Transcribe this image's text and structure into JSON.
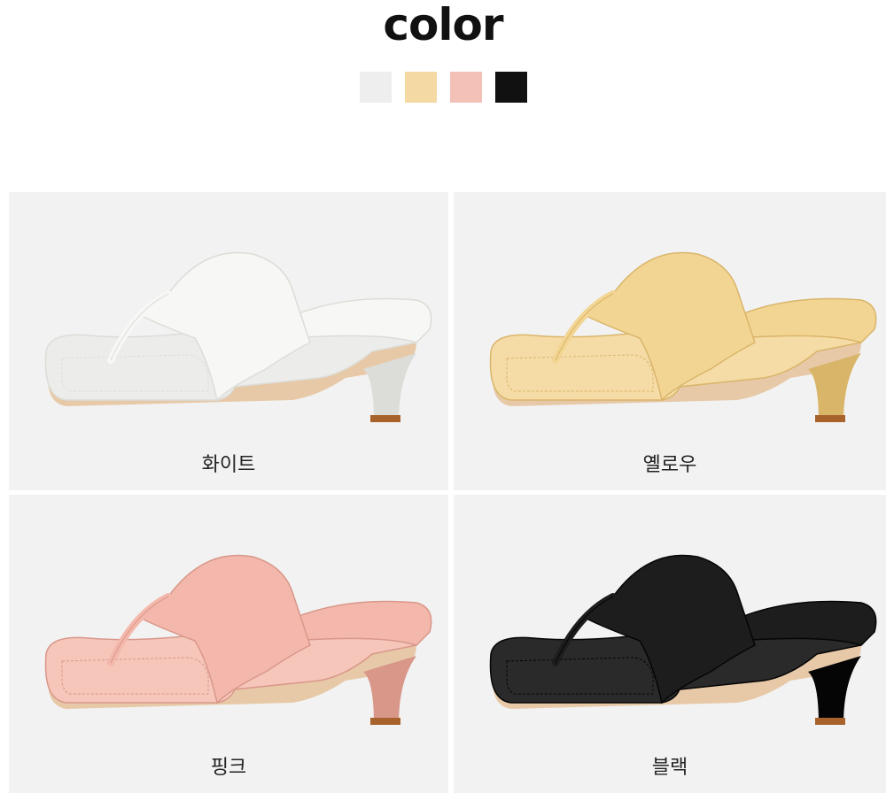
{
  "title": "color",
  "swatches": [
    {
      "name": "white",
      "color": "#eeeeee"
    },
    {
      "name": "yellow",
      "color": "#f4d9a3"
    },
    {
      "name": "pink",
      "color": "#f3c1b7"
    },
    {
      "name": "black",
      "color": "#111111"
    }
  ],
  "variants": [
    {
      "label": "화이트",
      "color": "#f7f7f5",
      "shade": "#dcdcd8",
      "inner": "#ececea"
    },
    {
      "label": "옐로우",
      "color": "#f3d593",
      "shade": "#d9b56a",
      "inner": "#f5dca6"
    },
    {
      "label": "핑크",
      "color": "#f3b8ab",
      "shade": "#d9978a",
      "inner": "#f6c6bb"
    },
    {
      "label": "블랙",
      "color": "#1d1d1d",
      "shade": "#050505",
      "inner": "#2a2a2a"
    }
  ]
}
